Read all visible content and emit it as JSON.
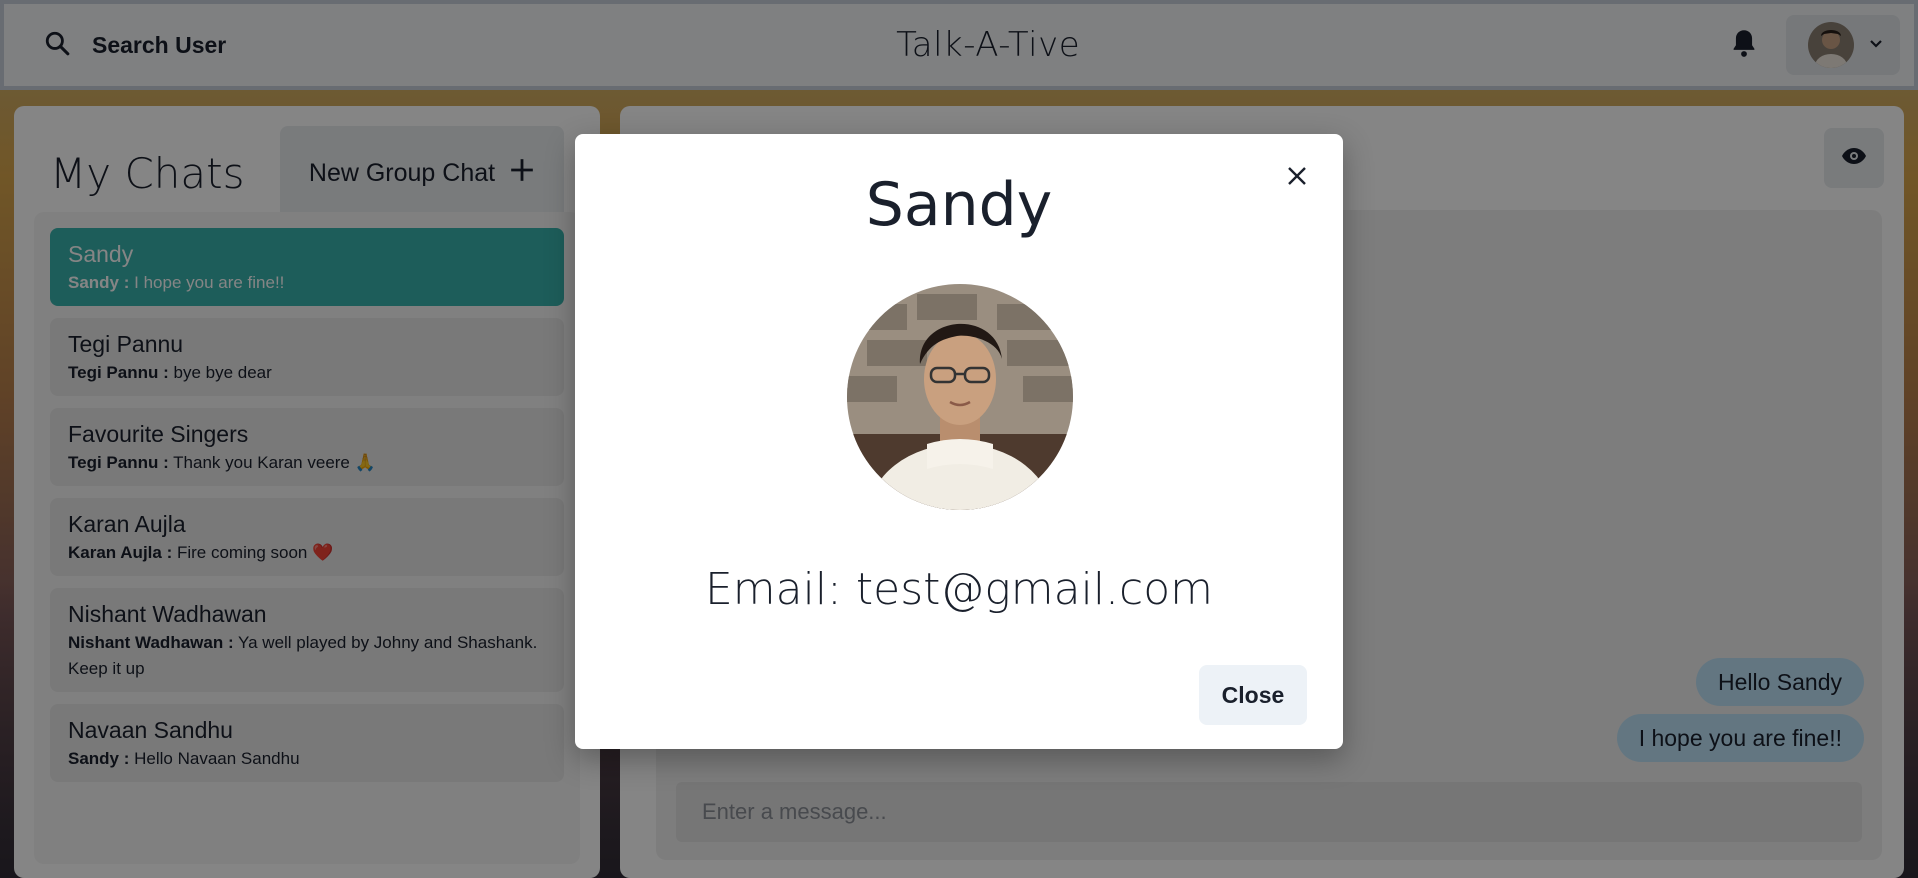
{
  "header": {
    "search_label": "Search User",
    "app_title": "Talk-A-Tive"
  },
  "chats": {
    "title": "My Chats",
    "new_group_label": "New Group Chat",
    "items": [
      {
        "name": "Sandy",
        "sender": "Sandy :",
        "message": "I hope you are fine!!",
        "active": true
      },
      {
        "name": "Tegi Pannu",
        "sender": "Tegi Pannu :",
        "message": "bye bye dear"
      },
      {
        "name": "Favourite Singers",
        "sender": "Tegi Pannu :",
        "message": "Thank you Karan veere 🙏"
      },
      {
        "name": "Karan Aujla",
        "sender": "Karan Aujla :",
        "message": "Fire coming soon ❤️"
      },
      {
        "name": "Nishant Wadhawan",
        "sender": "Nishant Wadhawan :",
        "message": "Ya well played by Johny and Shashank. Keep it up"
      },
      {
        "name": "Navaan Sandhu",
        "sender": "Sandy :",
        "message": "Hello Navaan Sandhu"
      }
    ]
  },
  "chatbox": {
    "messages": [
      "Hello Sandy",
      "I hope you are fine!!"
    ],
    "input_placeholder": "Enter a message..."
  },
  "modal": {
    "title": "Sandy",
    "email": "Email: test@gmail.com",
    "close_label": "Close"
  },
  "colors": {
    "accent": "#38b2ac",
    "bubble": "#bee3f8"
  }
}
